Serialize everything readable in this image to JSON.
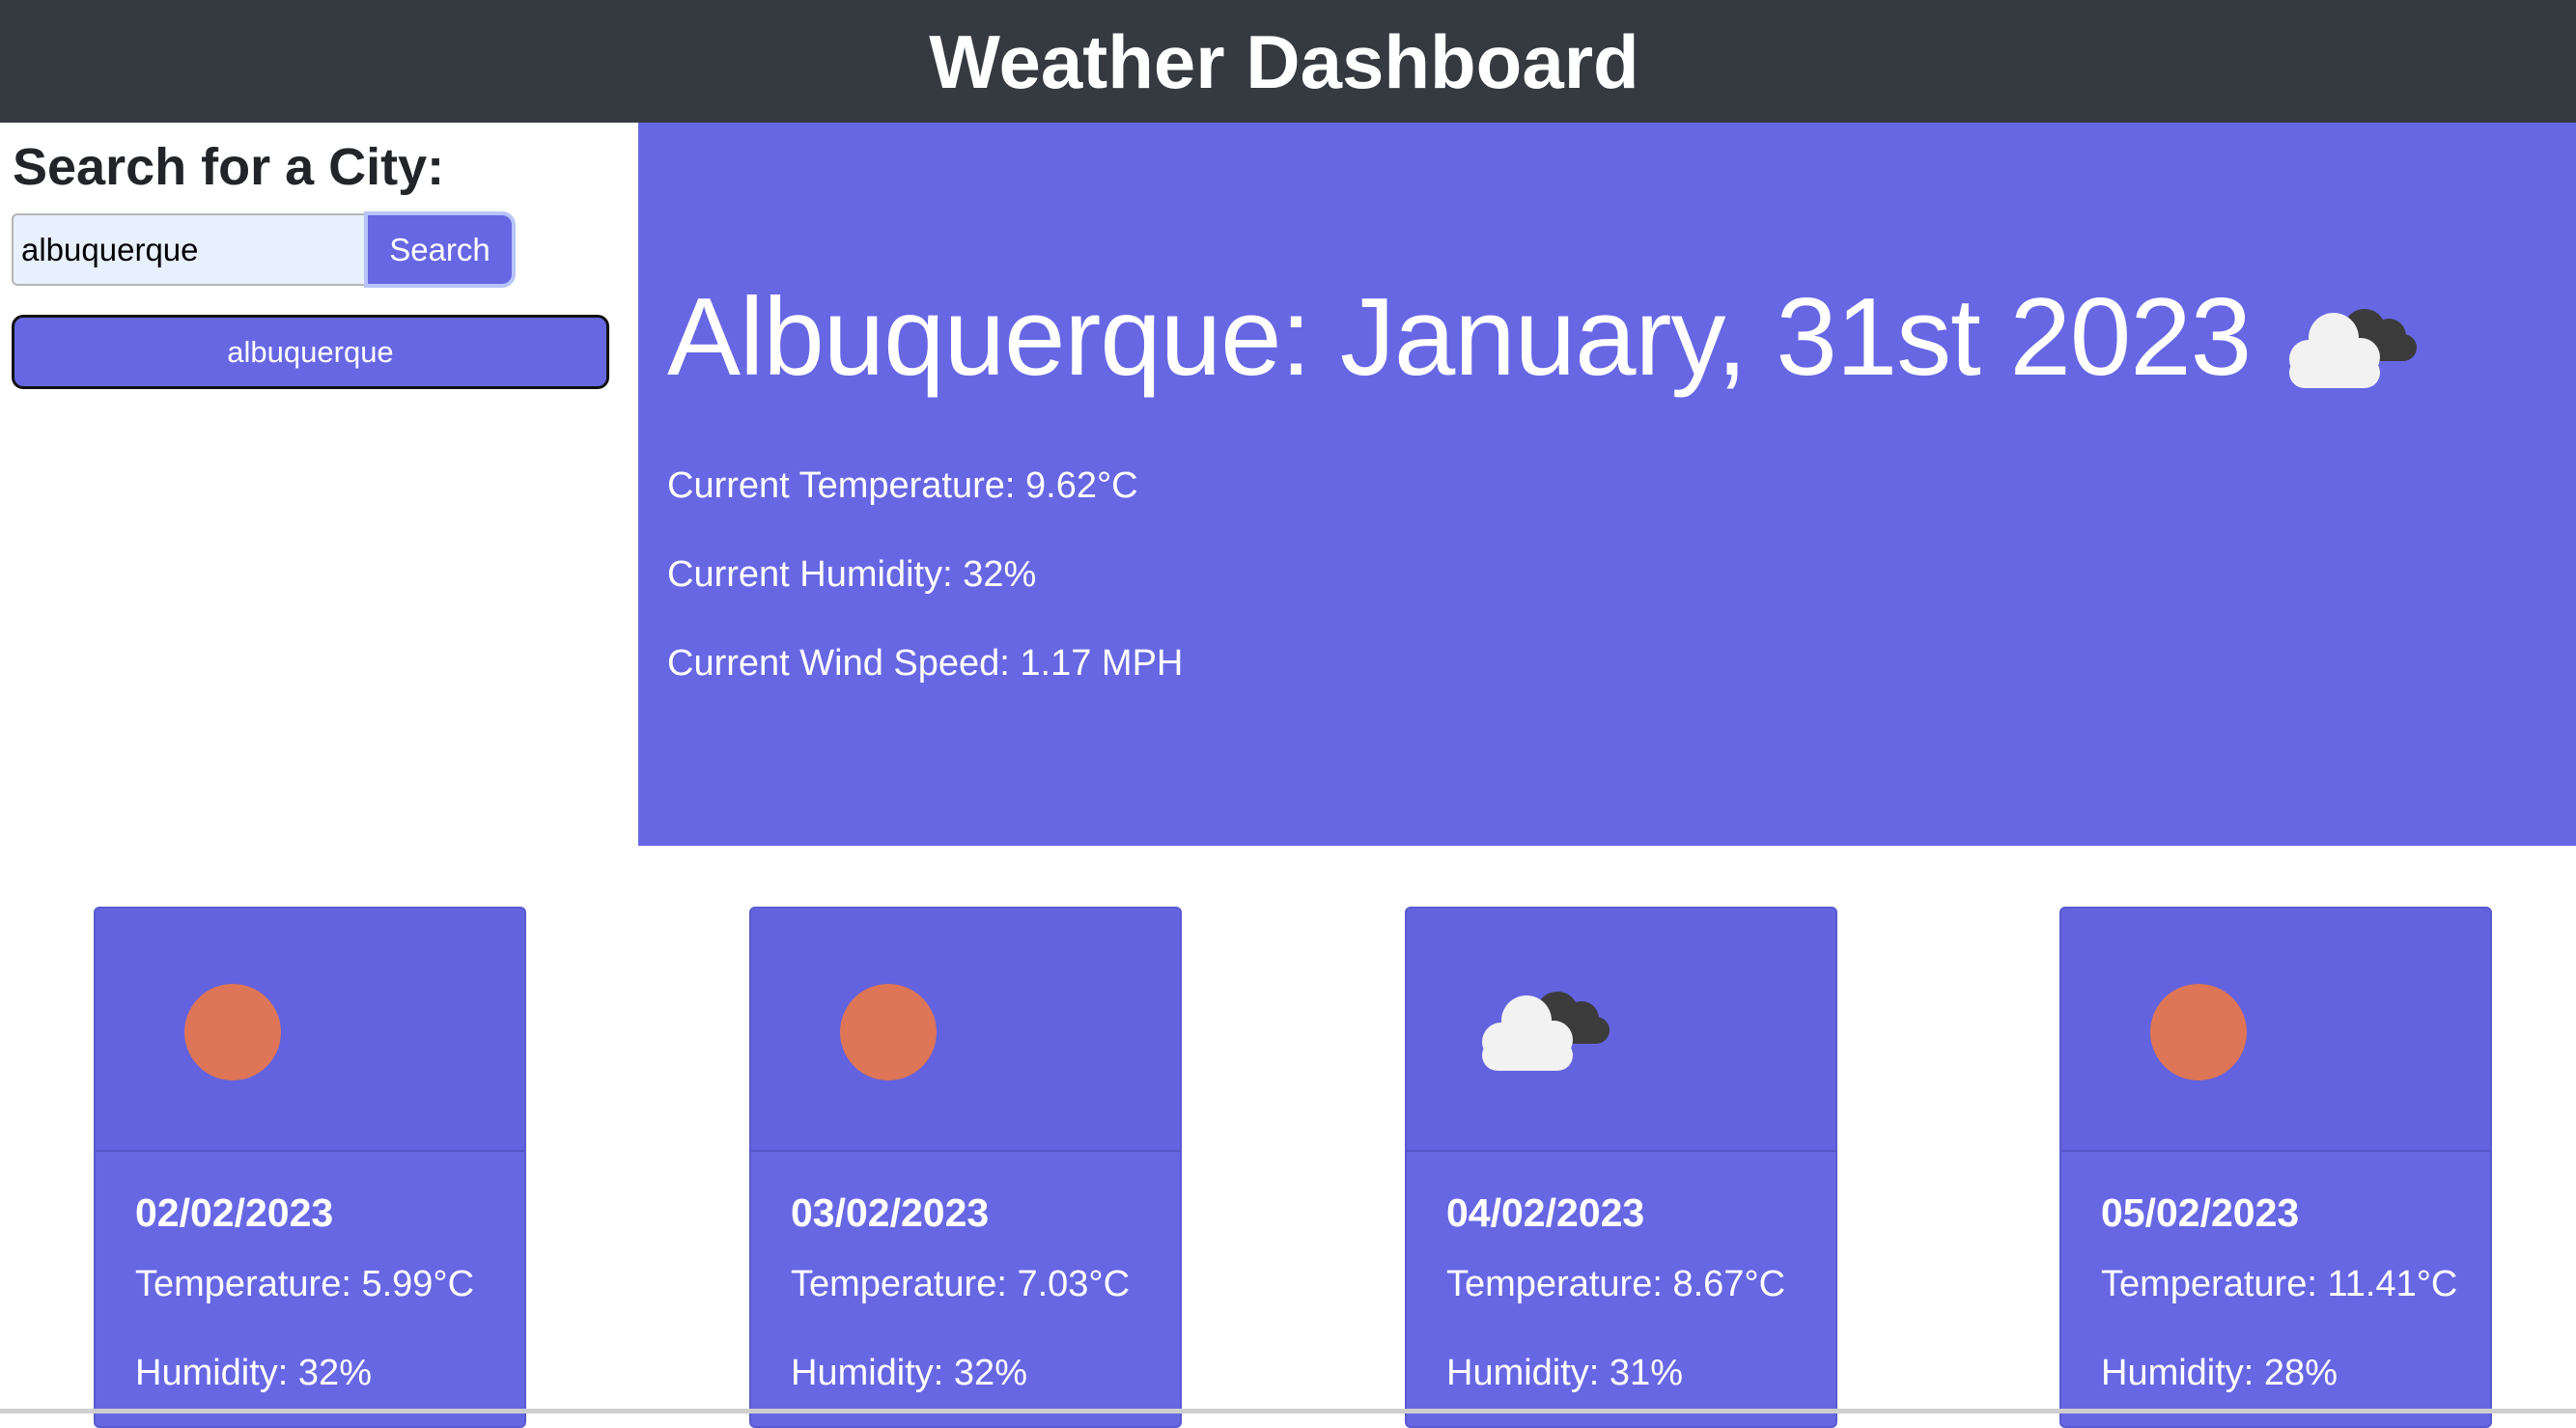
{
  "header": {
    "title": "Weather Dashboard"
  },
  "sidebar": {
    "heading": "Search for a City:",
    "search": {
      "value": "albuquerque",
      "button_label": "Search"
    },
    "history": [
      {
        "label": "albuquerque"
      }
    ]
  },
  "current": {
    "title": "Albuquerque: January, 31st 2023",
    "icon": "cloudy-icon",
    "temperature": "Current Temperature: 9.62°C",
    "humidity": "Current Humidity: 32%",
    "wind": "Current Wind Speed: 1.17 MPH"
  },
  "forecast": [
    {
      "date": "02/02/2023",
      "temperature": "Temperature: 5.99°C",
      "humidity": "Humidity: 32%",
      "icon": "sun-icon"
    },
    {
      "date": "03/02/2023",
      "temperature": "Temperature: 7.03°C",
      "humidity": "Humidity: 32%",
      "icon": "sun-icon"
    },
    {
      "date": "04/02/2023",
      "temperature": "Temperature: 8.67°C",
      "humidity": "Humidity: 31%",
      "icon": "cloudy-icon"
    },
    {
      "date": "05/02/2023",
      "temperature": "Temperature: 11.41°C",
      "humidity": "Humidity: 28%",
      "icon": "sun-icon"
    }
  ],
  "colors": {
    "header_bg": "#343a40",
    "accent": "#6767e4",
    "sun": "#dd7556",
    "cloud_light": "#f2f2f2",
    "cloud_dark": "#3b3b3b"
  }
}
